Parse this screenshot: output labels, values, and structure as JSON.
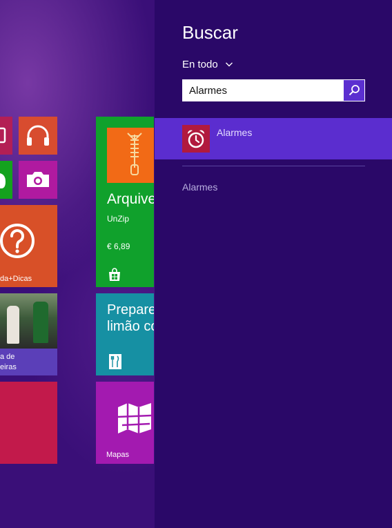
{
  "start_tiles": {
    "help_label": "da+Dicas",
    "sport_label_line1": "a de",
    "sport_label_line2": "eiras",
    "store_app": {
      "name": "Arquive",
      "developer": "UnZip",
      "price": "€ 6,89"
    },
    "food_title_line1": "Prepare",
    "food_title_line2": "limão co",
    "maps_label": "Mapas"
  },
  "search_pane": {
    "title": "Buscar",
    "scope_label": "En todo",
    "query": "Alarmes",
    "results": [
      {
        "label": "Alarmes",
        "icon": "alarm-clock-icon"
      }
    ],
    "suggestions": [
      "Alarmes"
    ]
  },
  "colors": {
    "pane_background": "#2a0868",
    "highlight": "#5b2dcf",
    "search_button": "#5b2fd0",
    "alarm_icon_bg": "#b11a3e"
  },
  "icons": {
    "phone": "phone-icon",
    "music": "headphones-icon",
    "games": "controller-icon",
    "camera": "camera-icon",
    "help": "question-mark-icon",
    "zip": "zipper-icon",
    "store": "windows-store-icon",
    "food": "fork-knife-icon",
    "maps": "map-icon",
    "search": "magnifier-icon",
    "chevron": "chevron-down-icon"
  }
}
